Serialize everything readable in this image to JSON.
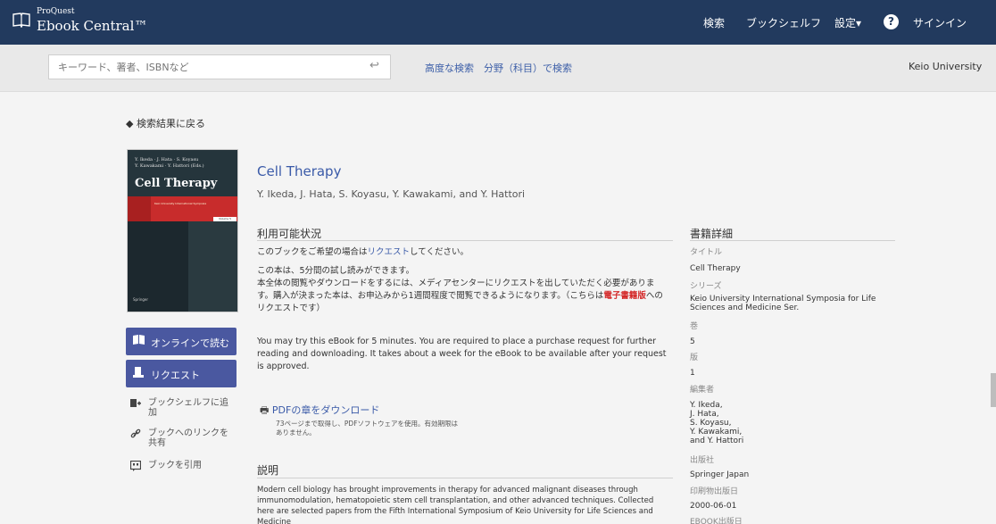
{
  "header": {
    "logo_small": "ProQuest",
    "logo_large": "Ebook Central™",
    "nav": [
      "検索",
      "ブックシェルフ",
      "設定▾",
      "サインイン"
    ],
    "help": "?"
  },
  "search": {
    "placeholder": "キーワード、著者、ISBNなど",
    "advanced": "高度な検索",
    "by_subject": "分野（科目）で検索",
    "institution": "Keio University"
  },
  "back_link": "検索結果に戻る",
  "cover": {
    "authors_line1": "Y. Ikeda · J. Hata · S. Koyasu",
    "authors_line2": "Y. Kawakami · Y. Hattori (Eds.)",
    "title": "Cell Therapy",
    "series_text": "Keio University International Symposia",
    "volume": "Volume 5",
    "publisher": "Springer"
  },
  "actions": {
    "read_online": "オンラインで読む",
    "request": "リクエスト",
    "add_bookshelf": "ブックシェルフに追加",
    "link_to_book": "ブックへのリンクを共有",
    "cite_book": "ブックを引用"
  },
  "book": {
    "title": "Cell Therapy",
    "authors": "Y. Ikeda, J. Hata, S. Koyasu, Y. Kawakami, and Y. Hattori"
  },
  "availability": {
    "heading": "利用可能状況",
    "line1_pre": "このブックをご希望の場合は",
    "line1_link": "リクエスト",
    "line1_post": "してください。",
    "line2": "この本は、5分間の試し読みができます。",
    "line3": "本全体の閲覧やダウンロードをするには、メディアセンターにリクエストを出していただく必要があります。購入が決まった本は、お申込みから1週間程度で閲覧できるようになります。（こちらは",
    "line3_red": "電子書籍版",
    "line3_post": "へのリクエストです）",
    "english": "You may try this eBook for 5 minutes. You are required to place a purchase request for further reading and downloading. It takes about a week for the eBook to be available after your request is approved."
  },
  "pdf": {
    "link": "PDFの章をダウンロード",
    "note": "73ページまで取得し、PDFソフトウェアを使用。有効期限はありません。"
  },
  "description": {
    "heading": "説明",
    "text": "Modern cell biology has brought improvements in therapy for advanced malignant diseases through immunomodulation, hematopoietic stem cell transplantation, and other advanced techniques. Collected here are selected papers from the Fifth International Symposium of Keio University for Life Sciences and Medicine"
  },
  "details": {
    "heading": "書籍詳細",
    "title_label": "タイトル",
    "title_value": "Cell Therapy",
    "series_label": "シリーズ",
    "series_value": "Keio University International Symposia for Life Sciences and Medicine Ser.",
    "volume_label": "巻",
    "volume_value": "5",
    "edition_label": "版",
    "edition_value": "1",
    "editors_label": "編集者",
    "editors_value": [
      "Y. Ikeda,",
      "J. Hata,",
      "S. Koyasu,",
      "Y. Kawakami,",
      "and Y. Hattori"
    ],
    "publisher_label": "出版社",
    "publisher_value": "Springer Japan",
    "print_date_label": "印刷物出版日",
    "print_date_value": "2000-06-01",
    "ebook_date_label": "EBOOK出版日"
  }
}
